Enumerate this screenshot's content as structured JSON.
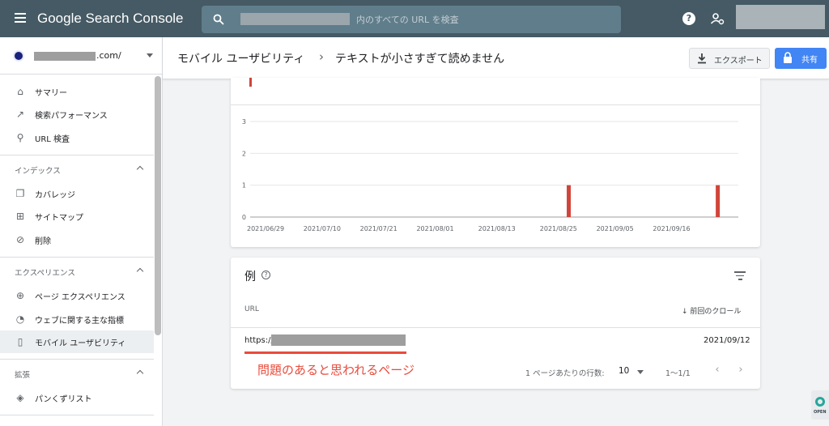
{
  "topbar": {
    "brand": "Google Search Console",
    "search_placeholder": "内のすべての URL を検査",
    "help_glyph": "?"
  },
  "sidebar": {
    "property_suffix": ".com/",
    "items_top": [
      {
        "label": "サマリー",
        "icon": "home-icon",
        "glyph": "⌂"
      },
      {
        "label": "検索パフォーマンス",
        "icon": "trending-icon",
        "glyph": "↗"
      },
      {
        "label": "URL 検査",
        "icon": "search-icon",
        "glyph": "⚲"
      }
    ],
    "sections": [
      {
        "title": "インデックス",
        "items": [
          {
            "label": "カバレッジ",
            "icon": "coverage-icon",
            "glyph": "❐"
          },
          {
            "label": "サイトマップ",
            "icon": "sitemap-icon",
            "glyph": "⊞"
          },
          {
            "label": "削除",
            "icon": "eye-off-icon",
            "glyph": "⊘"
          }
        ]
      },
      {
        "title": "エクスペリエンス",
        "items": [
          {
            "label": "ページ エクスペリエンス",
            "icon": "plus-circle-icon",
            "glyph": "⊕"
          },
          {
            "label": "ウェブに関する主な指標",
            "icon": "gauge-icon",
            "glyph": "◔"
          },
          {
            "label": "モバイル ユーザビリティ",
            "icon": "phone-icon",
            "glyph": "▯"
          }
        ]
      },
      {
        "title": "拡張",
        "items": [
          {
            "label": "パンくずリスト",
            "icon": "layers-icon",
            "glyph": "◈"
          }
        ]
      }
    ],
    "active_item": "モバイル ユーザビリティ"
  },
  "header": {
    "breadcrumb_parent": "モバイル ユーザビリティ",
    "breadcrumb_sep": "›",
    "breadcrumb_current": "テキストが小さすぎて読めません",
    "export_label": "エクスポート",
    "share_label": "共有"
  },
  "chart_data": {
    "type": "bar",
    "x_tick_labels": [
      "2021/06/29",
      "2021/07/10",
      "2021/07/21",
      "2021/08/01",
      "2021/08/13",
      "2021/08/25",
      "2021/09/05",
      "2021/09/16"
    ],
    "y_ticks": [
      0,
      1,
      2,
      3
    ],
    "ylim": [
      0,
      3
    ],
    "x_start": "2021/06/26",
    "x_end": "2021/09/29",
    "bars": [
      {
        "date": "2021/08/27",
        "value": 1
      },
      {
        "date": "2021/09/25",
        "value": 1
      }
    ],
    "bar_color": "#d0443a",
    "grid": true
  },
  "examples": {
    "title": "例",
    "help_glyph": "?",
    "col_url": "URL",
    "col_sort": "↓ 前回のクロール",
    "rows": [
      {
        "url_prefix": "https://",
        "date": "2021/09/12"
      }
    ],
    "rows_per_page_label": "1 ページあたりの行数:",
    "rows_per_page": "10",
    "range": "1〜1/1",
    "prev_glyph": "‹",
    "next_glyph": "›"
  },
  "annotation": {
    "text": "問題のあると思われるページ",
    "color": "#e94b3c"
  },
  "corner_badge": {
    "text": "OPEN"
  },
  "colors": {
    "topbar": "#455a64",
    "primary_button": "#4285f4"
  }
}
